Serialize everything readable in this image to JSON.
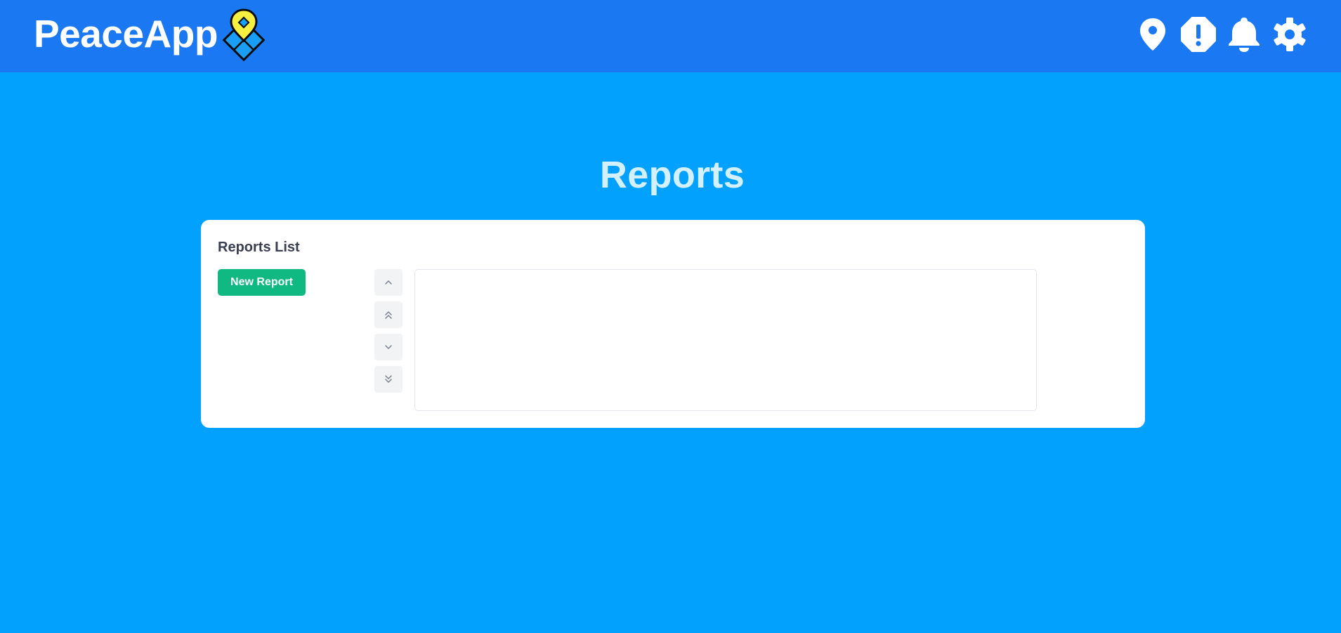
{
  "app": {
    "name": "PeaceApp",
    "logo_icon": "map-pin-grid-logo"
  },
  "header": {
    "icons": [
      {
        "name": "location-pin-icon"
      },
      {
        "name": "alert-octagon-icon"
      },
      {
        "name": "bell-icon"
      },
      {
        "name": "gear-icon"
      }
    ]
  },
  "page": {
    "title": "Reports"
  },
  "reports_panel": {
    "title": "Reports List",
    "new_button_label": "New Report",
    "order_buttons": [
      {
        "name": "move-up",
        "icon": "chevron-up-icon"
      },
      {
        "name": "move-top",
        "icon": "double-chevron-up-icon"
      },
      {
        "name": "move-down",
        "icon": "chevron-down-icon"
      },
      {
        "name": "move-bottom",
        "icon": "double-chevron-down-icon"
      }
    ],
    "items": []
  },
  "colors": {
    "header_bg": "#1a78f2",
    "page_bg": "#03a1fe",
    "title_text": "#d3f0ff",
    "accent_green": "#10b981",
    "logo_yellow": "#f7f040"
  }
}
